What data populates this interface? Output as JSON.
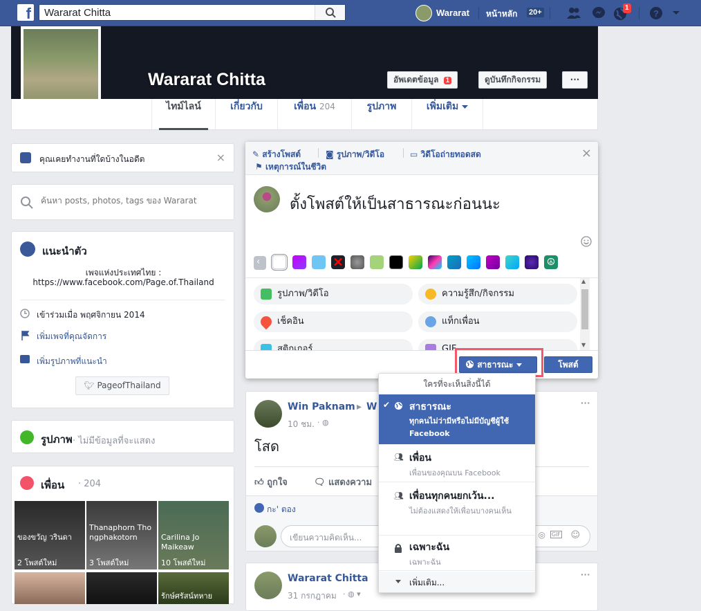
{
  "topbar": {
    "logo": "f",
    "search_value": "Wararat Chitta",
    "user_name": "Wararat",
    "home_label": "หน้าหลัก",
    "home_count": "20+",
    "notif_count": "1"
  },
  "profile": {
    "name": "Wararat Chitta",
    "update_info_label": "อัพเดตข้อมูล",
    "update_info_badge": "1",
    "activity_log_label": "ดูบันทึกกิจกรรม",
    "more_label": "···",
    "tabs": [
      {
        "label": "ไทม์ไลน์"
      },
      {
        "label": "เกี่ยวกับ"
      },
      {
        "label": "เพื่อน",
        "count": "204"
      },
      {
        "label": "รูปภาพ"
      },
      {
        "label": "เพิ่มเติม"
      }
    ]
  },
  "left": {
    "work_prompt": "คุณเคยทำงานที่ใดบ้างในอดีต",
    "search_placeholder": "ค้นหา posts, photos, tags ของ Wararat",
    "intro_title": "แนะนำตัว",
    "intro_text_1": "เพจแห่งประเทศไทย :",
    "intro_text_2": "https://www.facebook.com/Page.of.Thailand",
    "joined": "เข้าร่วมเมื่อ พฤศจิกายน 2014",
    "add_pages": "เพิ่มเพจที่คุณจัดการ",
    "add_photos": "เพิ่มรูปภาพที่แนะนำ",
    "twitter": "PageofThailand",
    "photos_title": "รูปภาพ",
    "photos_sub": "· ไม่มีข้อมูลที่จะแสดง",
    "friends_title": "เพื่อน",
    "friends_count": "· 204",
    "friends": [
      {
        "name": "ของขวัญ วรินดา",
        "posts": "2 โพสต์ใหม่"
      },
      {
        "name": "Thanaphorn Thongphakotorn",
        "posts": "3 โพสต์ใหม่"
      },
      {
        "name": "Carilina Jo Maikeaw",
        "posts": "10 โพสต์ใหม่"
      }
    ],
    "friend_partial_3": "รักษ์ศรัสน์ทหาย"
  },
  "composer": {
    "tab_create": "สร้างโพสต์",
    "tab_photo": "รูปภาพ/วิดีโอ",
    "tab_live": "วิดีโอถ่ายทอดสด",
    "tab_event": "เหตุการณ์ในชีวิต",
    "text": "ตั้งโพสต์ให้เป็นสาธารณะก่อนนะ",
    "chips": [
      {
        "label": "รูปภาพ/วิดีโอ"
      },
      {
        "label": "ความรู้สึก/กิจกรรม"
      },
      {
        "label": "เช็คอิน"
      },
      {
        "label": "แท็กเพื่อน"
      },
      {
        "label": "สติกเกอร์"
      },
      {
        "label": "GIF"
      }
    ],
    "privacy_label": "สาธารณะ",
    "post_label": "โพสต์"
  },
  "feed": {
    "post1": {
      "author": "Win Paknam",
      "author_extra": "W",
      "time": "10 ชม.",
      "text": "โสด",
      "like_label": "ถูกใจ",
      "comment_label": "แสดงความ",
      "liker": "กะ' ตอง",
      "comment_placeholder": "เขียนความคิดเห็น..."
    },
    "post2": {
      "author": "Wararat Chitta",
      "time": "31 กรกฎาคม"
    }
  },
  "privacy_menu": {
    "header": "ใครที่จะเห็นสิ่งนี้ได้",
    "items": [
      {
        "title": "สาธารณะ",
        "desc": "ทุกคนไม่ว่ามีหรือไม่มีบัญชีผู้ใช้ Facebook"
      },
      {
        "title": "เพื่อน",
        "desc": "เพื่อนของคุณบน Facebook"
      },
      {
        "title": "เพื่อนทุกคนยกเว้น...",
        "desc": "ไม่ต้องแสดงให้เพื่อนบางคนเห็น"
      },
      {
        "title": "เฉพาะฉัน",
        "desc": "เฉพาะฉัน"
      }
    ],
    "more": "เพิ่มเติม..."
  },
  "colors": {
    "brand": "#3b5998",
    "link": "#365899",
    "highlight_box": "#f15a6a",
    "menu_selected": "#4267b2"
  }
}
